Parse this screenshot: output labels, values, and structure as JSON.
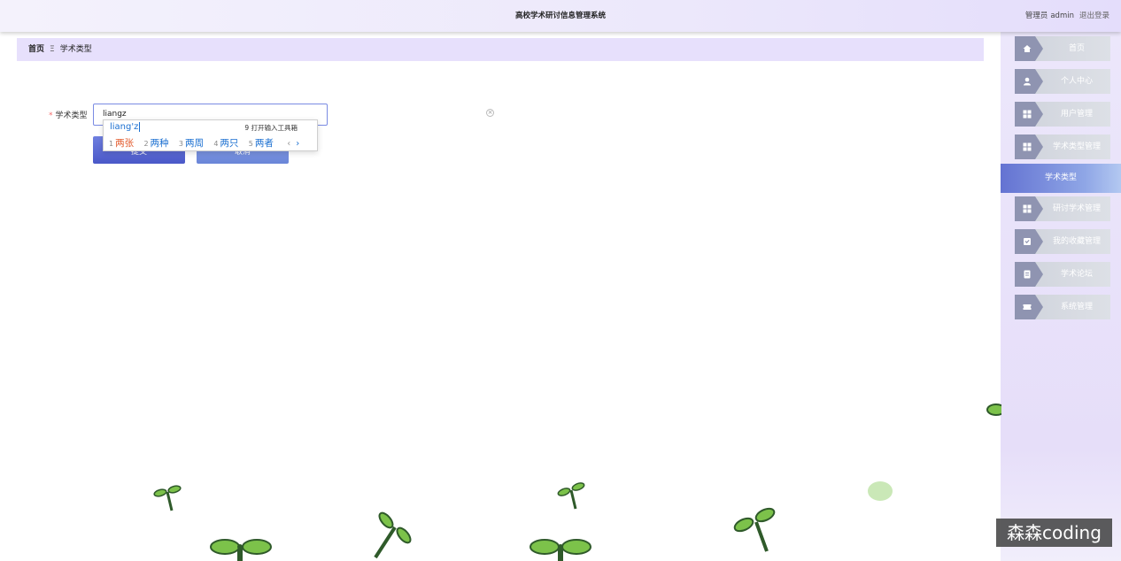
{
  "header": {
    "title": "高校学术研讨信息管理系统",
    "role": "管理员",
    "username": "admin",
    "logout_label": "退出登录"
  },
  "breadcrumb": {
    "home": "首页",
    "separator": "Ξ",
    "current": "学术类型"
  },
  "sidebar": {
    "items": [
      {
        "label": "首页",
        "icon": "home-icon"
      },
      {
        "label": "个人中心",
        "icon": "user-icon"
      },
      {
        "label": "用户管理",
        "icon": "grid-icon"
      },
      {
        "label": "学术类型管理",
        "icon": "grid-icon"
      },
      {
        "label": "学术类型",
        "icon": "none"
      },
      {
        "label": "研讨学术管理",
        "icon": "grid-icon"
      },
      {
        "label": "我的收藏管理",
        "icon": "bookmark-icon"
      },
      {
        "label": "学术论坛",
        "icon": "document-icon"
      },
      {
        "label": "系统管理",
        "icon": "ticket-icon"
      }
    ]
  },
  "form": {
    "required_mark": "*",
    "field_label": "学术类型",
    "field_value": "liangz",
    "submit_label": "提交",
    "cancel_label": "取消"
  },
  "ime": {
    "composition": "liang'z",
    "toolbox": "9 打开输入工具箱",
    "candidates": [
      {
        "num": "1",
        "text": "两张"
      },
      {
        "num": "2",
        "text": "两种"
      },
      {
        "num": "3",
        "text": "两周"
      },
      {
        "num": "4",
        "text": "两只"
      },
      {
        "num": "5",
        "text": "两者"
      }
    ],
    "prev": "‹",
    "next": "›"
  },
  "watermark": "森森coding",
  "colors": {
    "accent": "#5262cf",
    "header_bg": "#ece8fb",
    "breadcrumb_bg": "#e7e0fc",
    "sidebar_tag": "#8f94b1",
    "required": "#f56c6c",
    "propeller_leaf": "#7cc24a",
    "propeller_outline": "#2f5a2a"
  }
}
